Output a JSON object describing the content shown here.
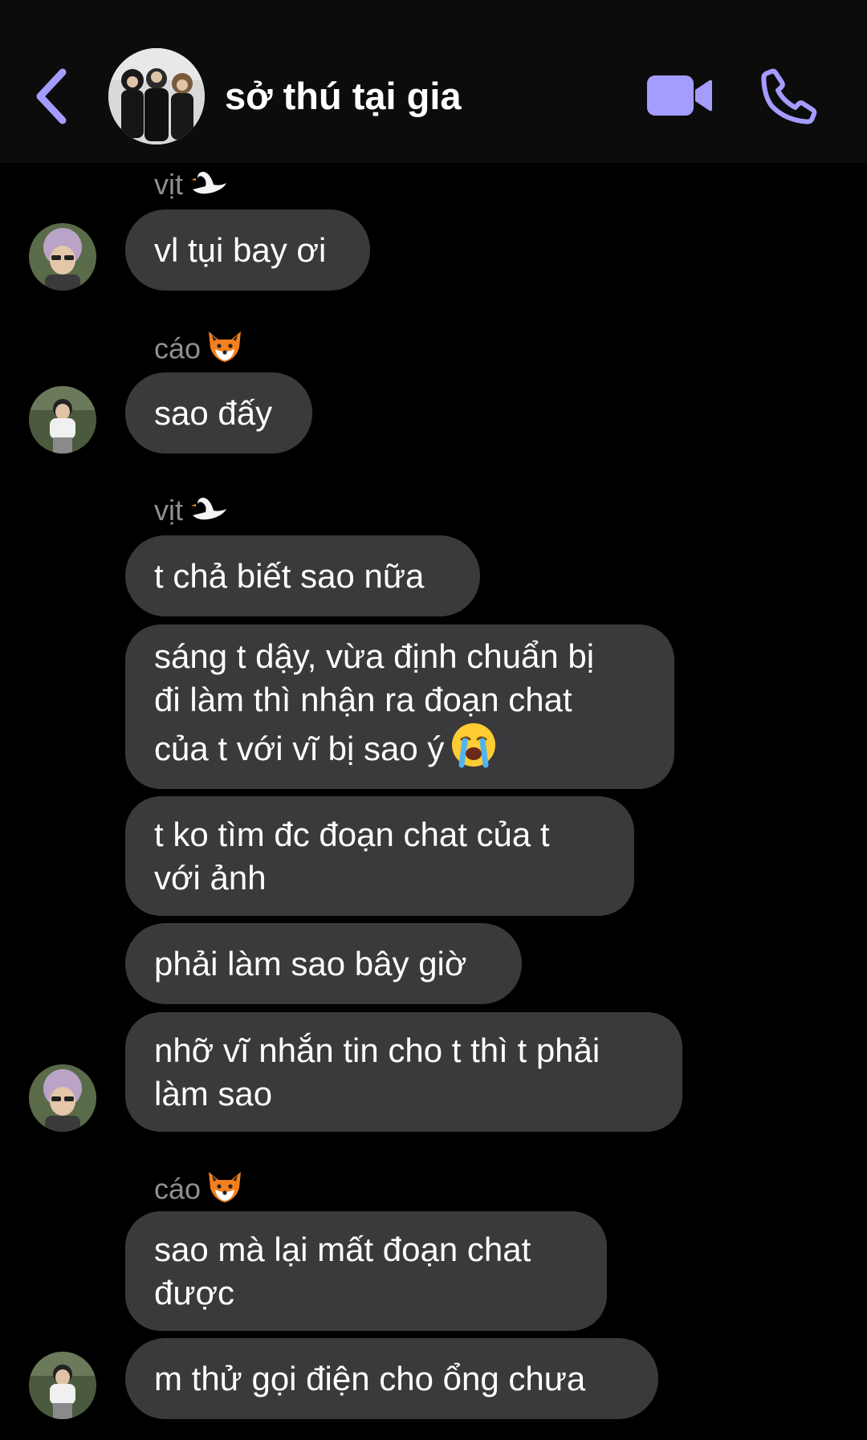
{
  "header": {
    "title": "sở thú tại gia",
    "back_icon": "chevron-left-icon",
    "video_icon": "video-camera-icon",
    "call_icon": "phone-icon",
    "accent_color": "#a59cff"
  },
  "messages": [
    {
      "sender": "vịt",
      "sender_emoji": "swan-emoji",
      "text": "vl tụi bay ơi"
    },
    {
      "sender": "cáo",
      "sender_emoji": "fox-emoji",
      "text": "sao đấy"
    },
    {
      "sender": "vịt",
      "sender_emoji": "swan-emoji",
      "text": "t chả biết sao nữa"
    },
    {
      "text": "sáng t dậy, vừa định chuẩn bị\nđi làm thì nhận ra đoạn chat\ncủa t với vĩ bị sao ý",
      "trailing_emoji": "crying-face-emoji"
    },
    {
      "text": "t ko tìm đc đoạn chat của t\nvới ảnh"
    },
    {
      "text": "phải làm sao bây giờ"
    },
    {
      "text": "nhỡ vĩ nhắn tin cho t thì t phải\nlàm sao"
    },
    {
      "sender": "cáo",
      "sender_emoji": "fox-emoji",
      "text": "sao mà lại mất đoạn chat\nđược"
    },
    {
      "text": "m thử gọi điện cho ổng chưa"
    }
  ],
  "colors": {
    "background": "#000000",
    "header_background": "#0c0c0c",
    "bubble": "#3a3a3c",
    "sender_name": "#8e8e93"
  }
}
